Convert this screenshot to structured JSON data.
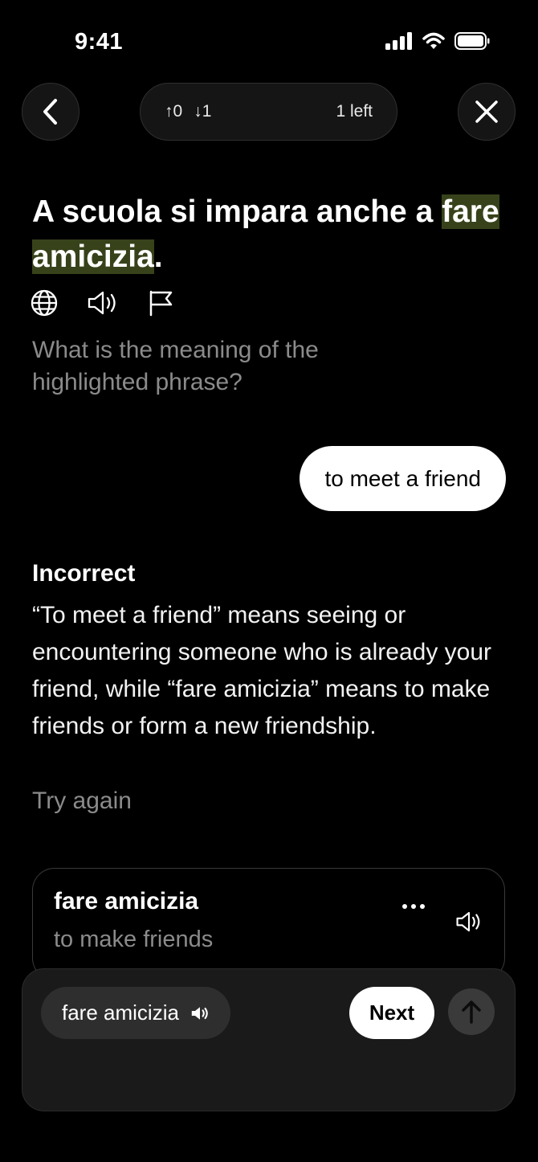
{
  "status": {
    "time": "9:41"
  },
  "header": {
    "up_count": "↑0",
    "down_count": "↓1",
    "remaining": "1 left"
  },
  "exercise": {
    "sentence_before": "A scuola si impara anche a ",
    "highlight": "fare amicizia",
    "sentence_after": ".",
    "prompt": "What is the meaning of the highlighted phrase?",
    "answer": "to meet a friend"
  },
  "feedback": {
    "verdict": "Incorrect",
    "explanation": "“To meet a friend” means seeing or encountering someone who is already your friend, while “fare amicizia” means to make friends or form a new friendship.",
    "retry": "Try again"
  },
  "vocab_card": {
    "term": "fare amicizia",
    "translation": "to make friends"
  },
  "bottom_bar": {
    "chip_label": "fare amicizia",
    "next_label": "Next"
  },
  "icons": [
    "back-icon",
    "close-icon",
    "globe-icon",
    "speaker-icon",
    "flag-icon",
    "more-icon",
    "arrow-up-icon"
  ],
  "colors": {
    "highlight": "#37421a",
    "background": "#000000",
    "muted_text": "#8b8b8b"
  }
}
